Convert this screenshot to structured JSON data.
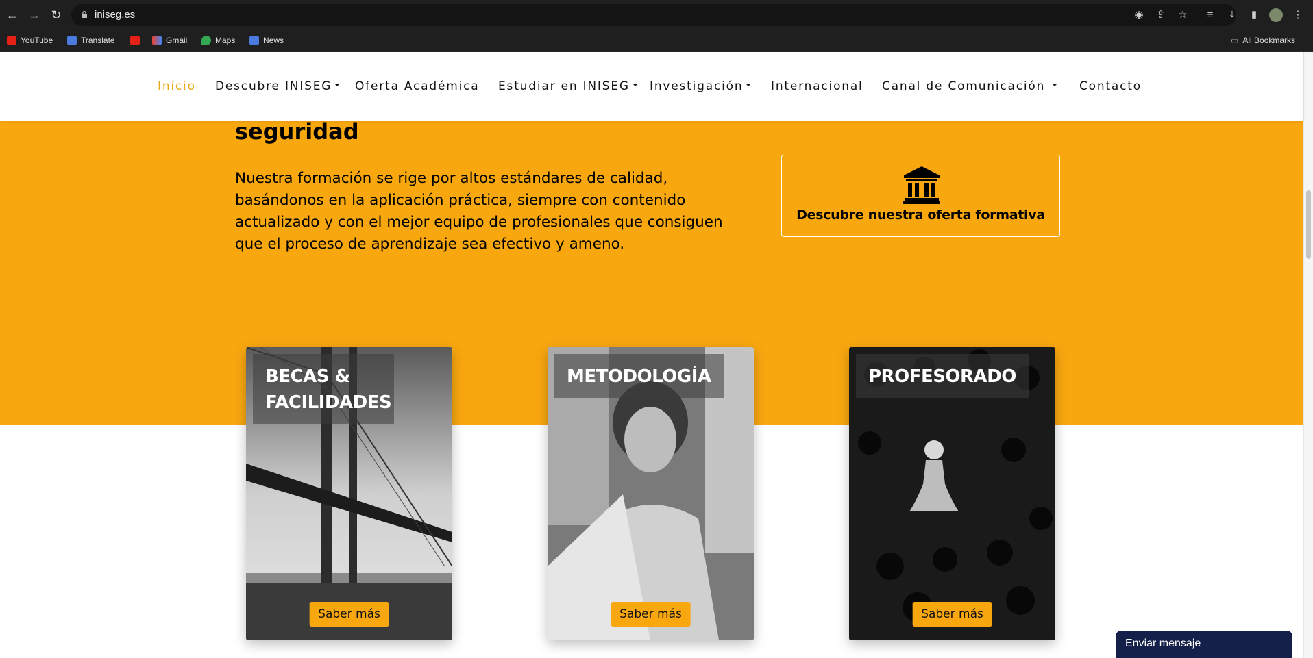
{
  "browser": {
    "url": "iniseg.es",
    "bookmarks": [
      "YouTube",
      "Translate",
      "",
      "Gmail",
      "Maps",
      "News"
    ],
    "all_bookmarks": "All Bookmarks"
  },
  "nav": {
    "items": [
      {
        "label": "Inicio",
        "active": true,
        "dropdown": false
      },
      {
        "label": "Descubre INISEG",
        "dropdown": true
      },
      {
        "label": "Oferta Académica",
        "dropdown": false
      },
      {
        "label": "Estudiar en INISEG",
        "dropdown": true
      },
      {
        "label": "Investigación",
        "dropdown": true
      },
      {
        "label": "Internacional",
        "dropdown": false
      },
      {
        "label": "Canal de Comunicación",
        "dropdown": true
      },
      {
        "label": "Contacto",
        "dropdown": false
      }
    ]
  },
  "hero": {
    "heading": "seguridad",
    "paragraph": "Nuestra formación se rige por altos estándares de calidad, basándonos en la aplicación práctica, siempre con contenido actualizado y con el mejor equipo de profesionales que consiguen que el proceso de aprendizaje sea efectivo y ameno.",
    "cta_label": "Descubre nuestra oferta formativa",
    "cta_icon": "bank-icon"
  },
  "cards": [
    {
      "title": "BECAS & FACILIDADES",
      "button": "Saber más",
      "image": "bridge-photo"
    },
    {
      "title": "METODOLOGÍA",
      "button": "Saber más",
      "image": "student-laptop-photo"
    },
    {
      "title": "PROFESORADO",
      "button": "Saber más",
      "image": "chess-pawns-photo"
    }
  ],
  "chat": {
    "label": "Enviar mensaje"
  },
  "colors": {
    "accent": "#f9a70f",
    "nav_active": "#e9a916",
    "chat_bg": "#14204a"
  }
}
